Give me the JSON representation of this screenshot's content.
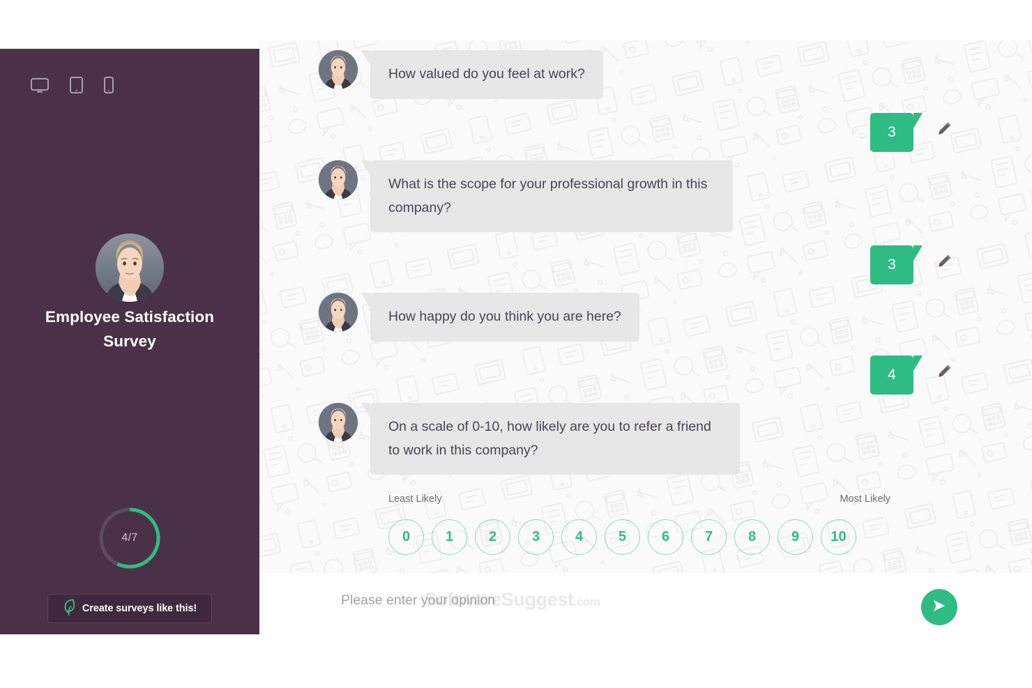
{
  "sidebar": {
    "devices": [
      {
        "name": "desktop-icon",
        "label": "Desktop"
      },
      {
        "name": "tablet-icon",
        "label": "Tablet"
      },
      {
        "name": "mobile-icon",
        "label": "Mobile"
      }
    ],
    "avatar_alt": "Survey host avatar",
    "title": "Employee Satisfaction Survey",
    "progress": {
      "label": "4/7",
      "current": 4,
      "total": 7,
      "percent": 57,
      "track_color": "#5e4c5c",
      "fill_color": "#2fbc84"
    },
    "cta": {
      "label": "Create surveys like this!",
      "logo_icon": "feather-logo-icon"
    },
    "background_color": "#4a3148"
  },
  "chat": {
    "messages": [
      {
        "role": "question",
        "text": "How valued do you feel at work?"
      },
      {
        "role": "answer",
        "value": "3",
        "edit_icon": "pencil-icon"
      },
      {
        "role": "question",
        "text": "What is the scope for your professional growth in this company?"
      },
      {
        "role": "answer",
        "value": "3",
        "edit_icon": "pencil-icon"
      },
      {
        "role": "question",
        "text": "How happy do you think you are here?"
      },
      {
        "role": "answer",
        "value": "4",
        "edit_icon": "pencil-icon"
      },
      {
        "role": "question",
        "text": "On a scale of 0-10, how likely are you to refer a friend to work in this company?"
      }
    ],
    "bubble_color": "#e7e7e8",
    "answer_color": "#2fbc84"
  },
  "nps": {
    "least_label": "Least Likely",
    "most_label": "Most Likely",
    "options": [
      "0",
      "1",
      "2",
      "3",
      "4",
      "5",
      "6",
      "7",
      "8",
      "9",
      "10"
    ],
    "accent_color": "#2fbc84"
  },
  "composer": {
    "placeholder": "Please enter your opinion",
    "value": "",
    "send_icon": "send-paper-plane-icon"
  },
  "watermark": {
    "brand": "SoftwareSuggest",
    "tld": ".com"
  }
}
